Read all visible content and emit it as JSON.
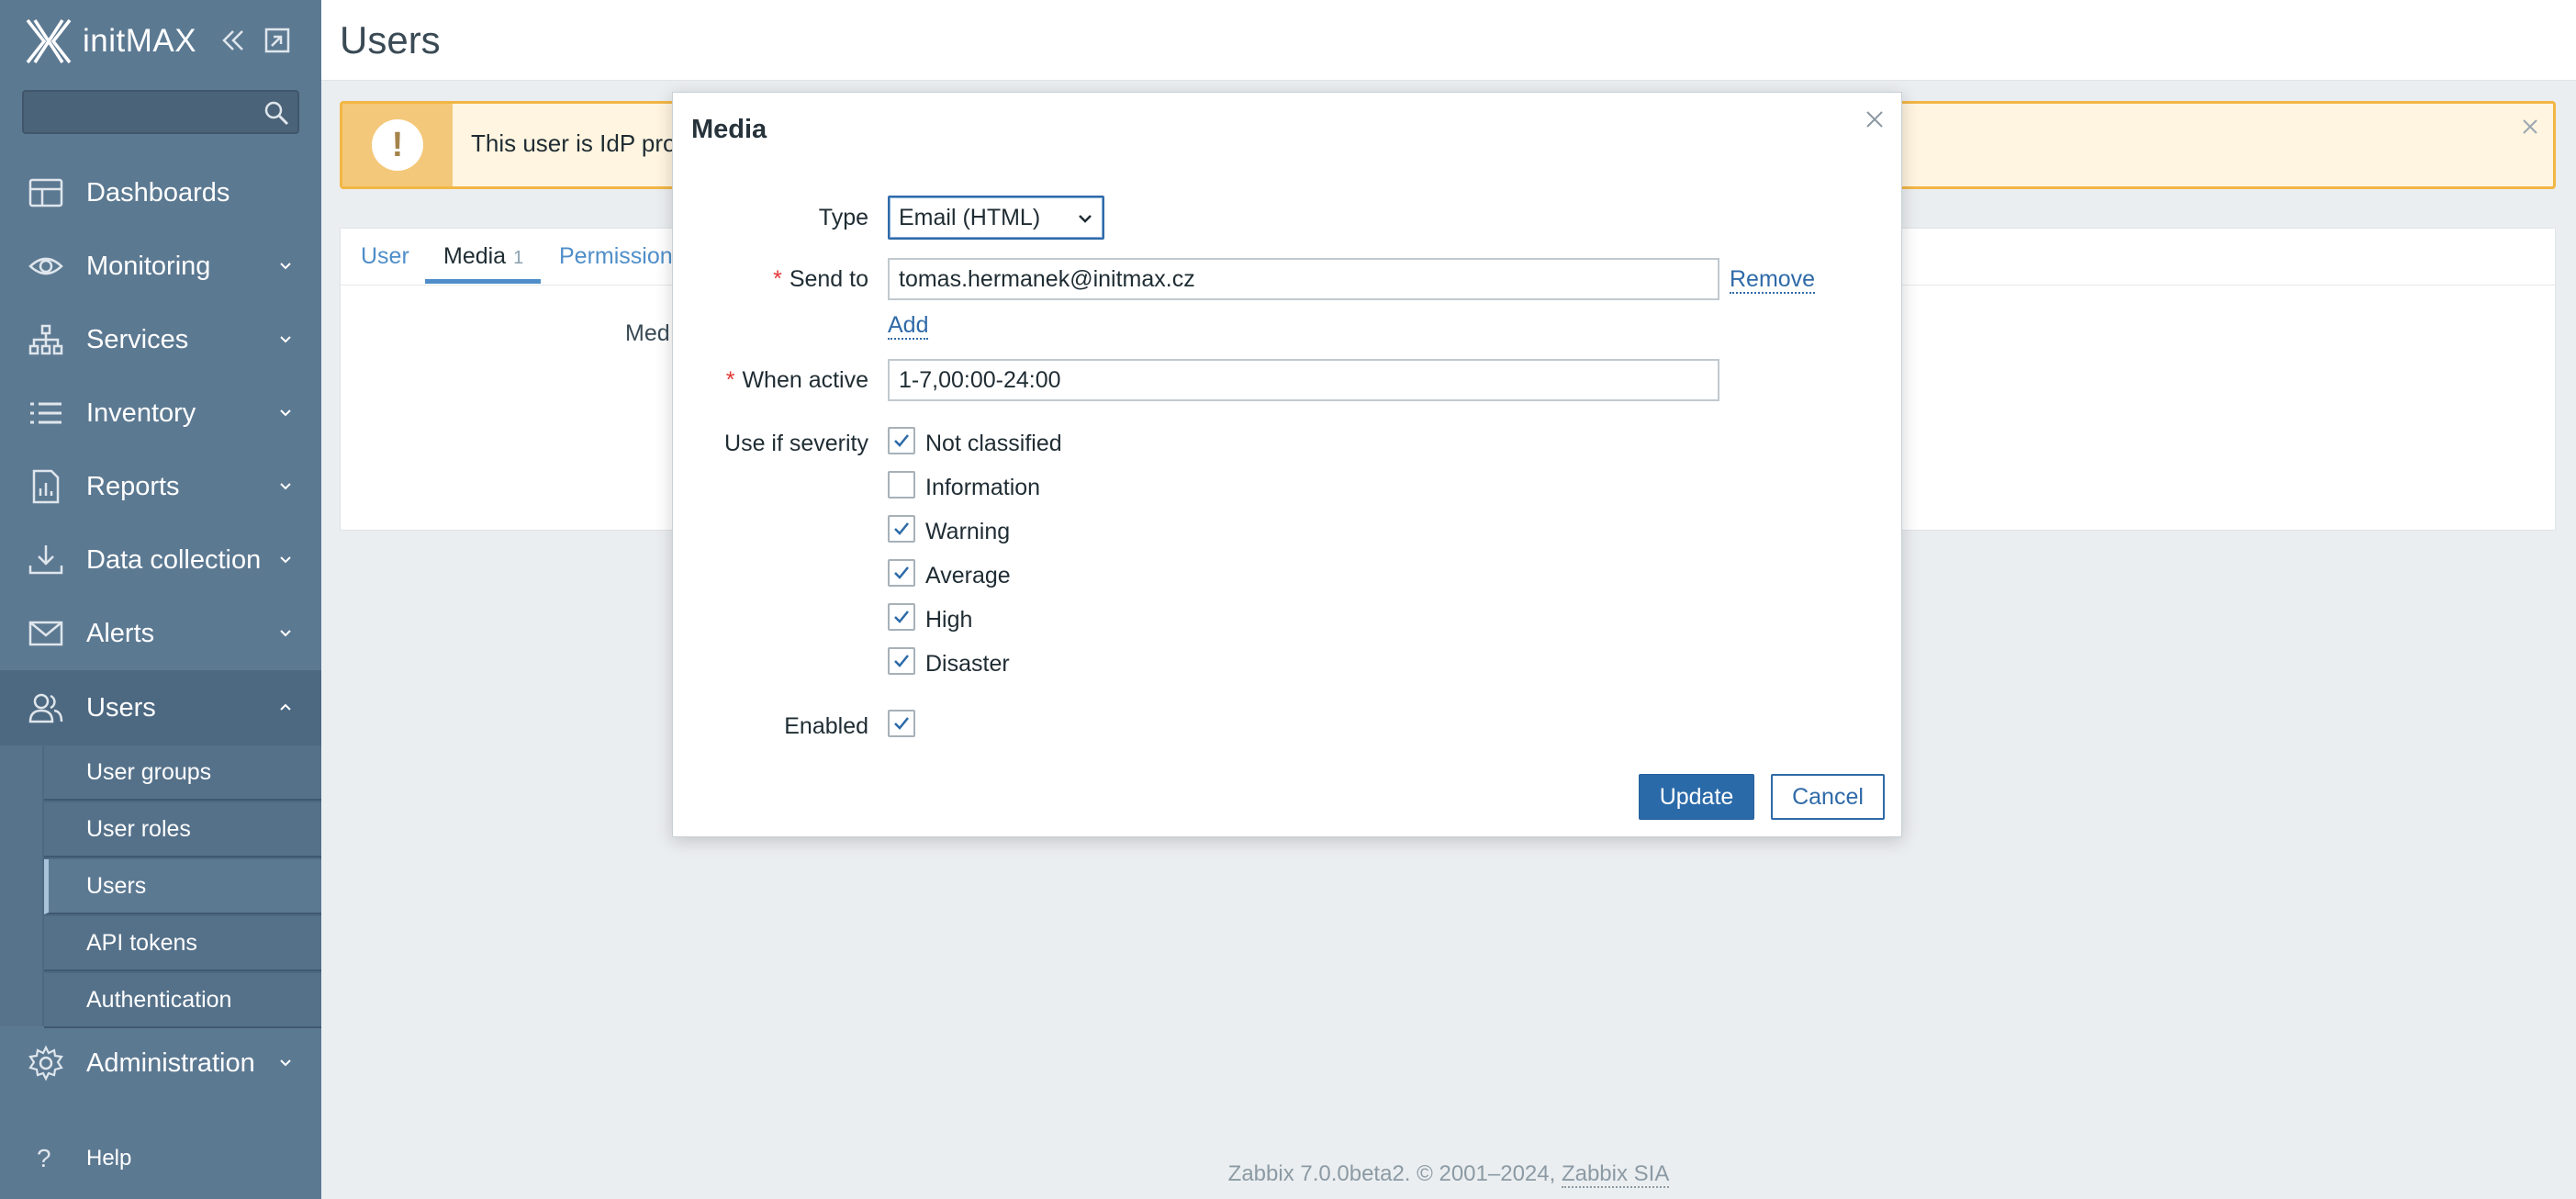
{
  "brand": {
    "name": "initMAX"
  },
  "sidebar": {
    "search_placeholder": "",
    "items": [
      {
        "label": "Dashboards",
        "icon": "dashboards-icon"
      },
      {
        "label": "Monitoring",
        "icon": "eye-icon"
      },
      {
        "label": "Services",
        "icon": "services-icon"
      },
      {
        "label": "Inventory",
        "icon": "list-icon"
      },
      {
        "label": "Reports",
        "icon": "reports-icon"
      },
      {
        "label": "Data collection",
        "icon": "download-icon"
      },
      {
        "label": "Alerts",
        "icon": "envelope-icon"
      },
      {
        "label": "Users",
        "icon": "users-icon"
      },
      {
        "label": "Administration",
        "icon": "gear-icon"
      }
    ],
    "users_submenu": [
      "User groups",
      "User roles",
      "Users",
      "API tokens",
      "Authentication"
    ],
    "help_label": "Help"
  },
  "header": {
    "title": "Users"
  },
  "banner": {
    "text": "This user is IdP provi"
  },
  "form": {
    "tabs": [
      {
        "label": "User"
      },
      {
        "label": "Media",
        "count": "1"
      },
      {
        "label": "Permissions"
      }
    ],
    "media_label": "Med"
  },
  "modal": {
    "title": "Media",
    "type_label": "Type",
    "type_value": "Email (HTML)",
    "send_to_label": "Send to",
    "send_to_value": "tomas.hermanek@initmax.cz",
    "remove_label": "Remove",
    "add_label": "Add",
    "when_active_label": "When active",
    "when_active_value": "1-7,00:00-24:00",
    "severity_label": "Use if severity",
    "severities": [
      {
        "label": "Not classified",
        "checked": true
      },
      {
        "label": "Information",
        "checked": false
      },
      {
        "label": "Warning",
        "checked": true
      },
      {
        "label": "Average",
        "checked": true
      },
      {
        "label": "High",
        "checked": true
      },
      {
        "label": "Disaster",
        "checked": true
      }
    ],
    "enabled_label": "Enabled",
    "enabled_checked": true,
    "update_label": "Update",
    "cancel_label": "Cancel"
  },
  "footer": {
    "text": "Zabbix 7.0.0beta2. © 2001–2024,",
    "link": "Zabbix SIA"
  },
  "colors": {
    "sidebar": "#5c7992",
    "accent": "#2b6aa8",
    "warning": "#f2b645"
  }
}
